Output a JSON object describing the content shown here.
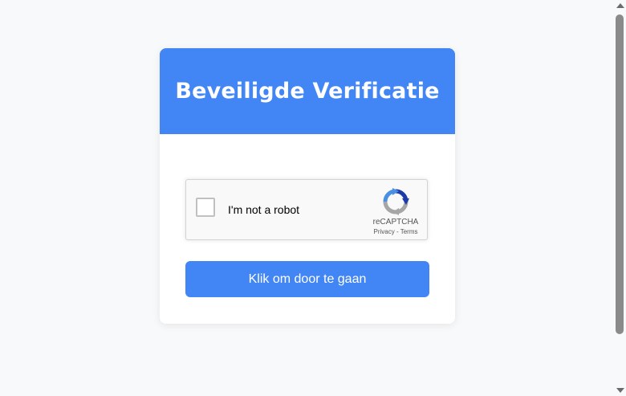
{
  "page": {
    "title": "Beveiligde Verificatie"
  },
  "recaptcha": {
    "checkbox_label": "I'm not a robot",
    "checked": false,
    "brand": "reCAPTCHA",
    "privacy_link": "Privacy",
    "separator": "-",
    "terms_link": "Terms",
    "logo_icon": "recaptcha-logo-icon"
  },
  "actions": {
    "continue_label": "Klik om door te gaan"
  },
  "colors": {
    "accent": "#4285f4",
    "background": "#f8f9fa",
    "card": "#ffffff"
  }
}
